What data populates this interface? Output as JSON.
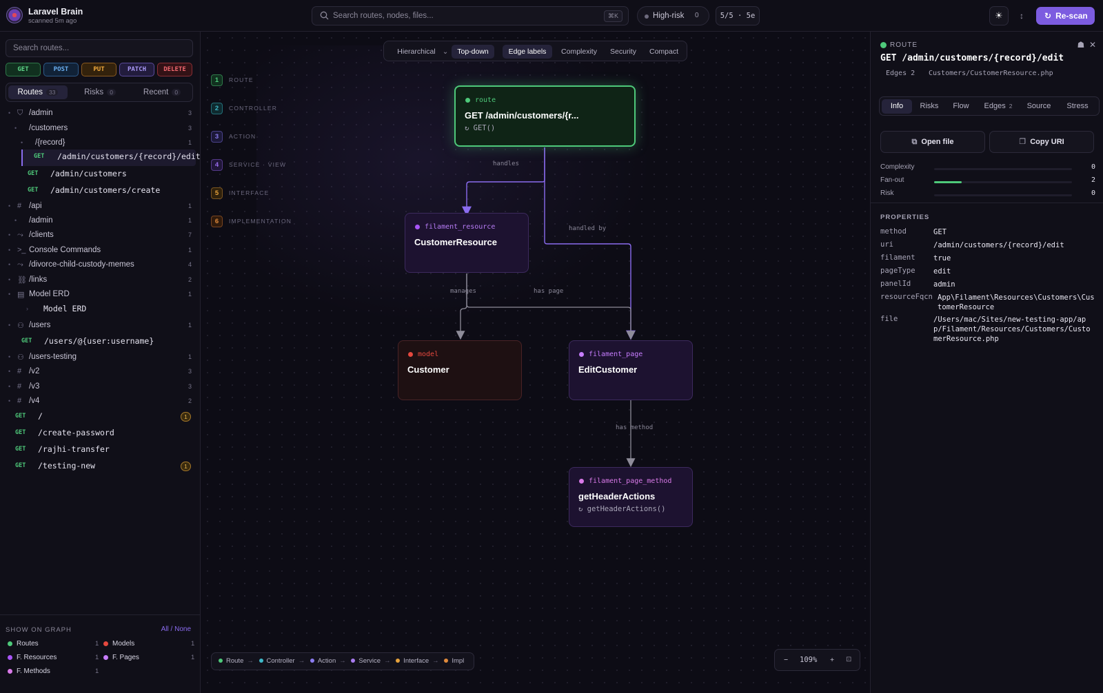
{
  "app": {
    "name": "Laravel Brain",
    "scanned": "scanned 5m ago"
  },
  "header": {
    "search_placeholder": "Search routes, nodes, files...",
    "search_shortcut": "⌘K",
    "high_risk_label": "High-risk",
    "high_risk_count": "0",
    "stats": "5/5 · 5e",
    "rescan_label": "Re-scan"
  },
  "sidebar": {
    "search_placeholder": "Search routes...",
    "methods": [
      "GET",
      "POST",
      "PUT",
      "PATCH",
      "DELETE"
    ],
    "tabs": [
      {
        "label": "Routes",
        "count": "33"
      },
      {
        "label": "Risks",
        "count": "0"
      },
      {
        "label": "Recent",
        "count": "0"
      }
    ],
    "tree": [
      {
        "kind": "group",
        "icon": "shield-icon",
        "label": "/admin",
        "count": "3",
        "indent": 0
      },
      {
        "kind": "group",
        "icon": "",
        "label": "/customers",
        "count": "3",
        "indent": 1
      },
      {
        "kind": "group",
        "icon": "",
        "label": "/{record}",
        "count": "1",
        "indent": 2
      },
      {
        "kind": "route",
        "method": "GET",
        "label": "/admin/customers/{record}/edit",
        "selected": true,
        "indent": 3
      },
      {
        "kind": "route",
        "method": "GET",
        "label": "/admin/customers",
        "indent": 2
      },
      {
        "kind": "route",
        "method": "GET",
        "label": "/admin/customers/create",
        "indent": 2
      },
      {
        "kind": "group",
        "icon": "hash-icon",
        "label": "/api",
        "count": "1",
        "indent": 0
      },
      {
        "kind": "group",
        "icon": "",
        "label": "/admin",
        "count": "1",
        "indent": 1
      },
      {
        "kind": "group",
        "icon": "route-icon",
        "label": "/clients",
        "count": "7",
        "indent": 0
      },
      {
        "kind": "group",
        "icon": "terminal-icon",
        "label": "Console Commands",
        "count": "1",
        "indent": 0
      },
      {
        "kind": "group",
        "icon": "route-icon",
        "label": "/divorce-child-custody-memes",
        "count": "4",
        "indent": 0
      },
      {
        "kind": "group",
        "icon": "link-icon",
        "label": "/links",
        "count": "2",
        "indent": 0
      },
      {
        "kind": "group",
        "icon": "database-icon",
        "label": "Model ERD",
        "count": "1",
        "indent": 0
      },
      {
        "kind": "leaf",
        "label": "Model ERD",
        "indent": 1
      },
      {
        "kind": "group",
        "icon": "user-icon",
        "label": "/users",
        "count": "1",
        "indent": 0
      },
      {
        "kind": "route",
        "method": "GET",
        "label": "/users/@{user:username}",
        "indent": 1
      },
      {
        "kind": "group",
        "icon": "user-icon",
        "label": "/users-testing",
        "count": "1",
        "indent": 0
      },
      {
        "kind": "group",
        "icon": "hash-icon",
        "label": "/v2",
        "count": "3",
        "indent": 0
      },
      {
        "kind": "group",
        "icon": "hash-icon",
        "label": "/v3",
        "count": "3",
        "indent": 0
      },
      {
        "kind": "group",
        "icon": "hash-icon",
        "label": "/v4",
        "count": "2",
        "indent": 0
      },
      {
        "kind": "route",
        "method": "GET",
        "label": "/",
        "badge": "1",
        "indent": 0
      },
      {
        "kind": "route",
        "method": "GET",
        "label": "/create-password",
        "indent": 0
      },
      {
        "kind": "route",
        "method": "GET",
        "label": "/rajhi-transfer",
        "indent": 0
      },
      {
        "kind": "route",
        "method": "GET",
        "label": "/testing-new",
        "badge": "1",
        "indent": 0
      }
    ],
    "show_on_graph": {
      "heading": "SHOW ON GRAPH",
      "all": "All",
      "none": "None",
      "items": [
        {
          "label": "Routes",
          "count": "1",
          "color": "#4ec97a"
        },
        {
          "label": "Models",
          "count": "1",
          "color": "#e5483e"
        },
        {
          "label": "F. Resources",
          "count": "1",
          "color": "#a855f7"
        },
        {
          "label": "F. Pages",
          "count": "1",
          "color": "#c77dff"
        },
        {
          "label": "F. Methods",
          "count": "1",
          "color": "#d97ae8"
        }
      ]
    }
  },
  "canvas": {
    "toolbar": [
      "Hierarchical",
      "Top-down",
      "Edge labels",
      "Complexity",
      "Security",
      "Compact"
    ],
    "lanes": [
      {
        "num": "1",
        "label": "ROUTE",
        "color": "#4ec97a"
      },
      {
        "num": "2",
        "label": "CONTROLLER",
        "color": "#3fb8c9"
      },
      {
        "num": "3",
        "label": "ACTION",
        "color": "#8b7cf0"
      },
      {
        "num": "4",
        "label": "SERVICE · VIEW",
        "color": "#9b6cf0"
      },
      {
        "num": "5",
        "label": "INTERFACE",
        "color": "#e6a23c"
      },
      {
        "num": "6",
        "label": "IMPLEMENTATION",
        "color": "#e08a3c"
      }
    ],
    "nodes": {
      "route": {
        "kind": "route",
        "title": "GET /admin/customers/{r...",
        "sub": "↻ GET()"
      },
      "resource": {
        "kind": "filament_resource",
        "title": "CustomerResource"
      },
      "model": {
        "kind": "model",
        "title": "Customer"
      },
      "page": {
        "kind": "filament_page",
        "title": "EditCustomer"
      },
      "method": {
        "kind": "filament_page_method",
        "title": "getHeaderActions",
        "sub": "↻ getHeaderActions()"
      }
    },
    "edges": {
      "handles": "handles",
      "handled_by": "handled by",
      "manages": "manages",
      "has_page": "has page",
      "has_method": "has method"
    },
    "flow_legend": [
      {
        "label": "Route",
        "color": "#4ec97a"
      },
      {
        "label": "Controller",
        "color": "#3fb8c9"
      },
      {
        "label": "Action",
        "color": "#8b7cf0"
      },
      {
        "label": "Service",
        "color": "#a97cf0"
      },
      {
        "label": "Interface",
        "color": "#e6a23c"
      },
      {
        "label": "Impl",
        "color": "#e08a3c"
      }
    ],
    "zoom": {
      "minus": "−",
      "level": "109%",
      "plus": "+"
    }
  },
  "panel": {
    "kind": "ROUTE",
    "title": "GET /admin/customers/{record}/edit",
    "edges": "Edges 2",
    "file": "Customers/CustomerResource.php",
    "tabs": [
      {
        "label": "Info",
        "count": ""
      },
      {
        "label": "Risks",
        "count": ""
      },
      {
        "label": "Flow",
        "count": ""
      },
      {
        "label": "Edges",
        "count": "2"
      },
      {
        "label": "Source",
        "count": ""
      },
      {
        "label": "Stress",
        "count": ""
      }
    ],
    "open_file": "Open file",
    "copy_uri": "Copy URI",
    "metrics": [
      {
        "label": "Complexity",
        "value": "0",
        "level": 0
      },
      {
        "label": "Fan-out",
        "value": "2",
        "level": 0.2
      },
      {
        "label": "Risk",
        "value": "0",
        "level": 0
      }
    ],
    "properties_heading": "PROPERTIES",
    "properties": [
      {
        "key": "method",
        "value": "GET"
      },
      {
        "key": "uri",
        "value": "/admin/customers/{record}/edit"
      },
      {
        "key": "filament",
        "value": "true"
      },
      {
        "key": "pageType",
        "value": "edit"
      },
      {
        "key": "panelId",
        "value": "admin"
      },
      {
        "key": "resourceFqcn",
        "value": "App\\Filament\\Resources\\Customers\\CustomerResource"
      },
      {
        "key": "file",
        "value": "/Users/mac/Sites/new-testing-app/app/Filament/Resources/Customers/CustomerResource.php"
      }
    ]
  }
}
